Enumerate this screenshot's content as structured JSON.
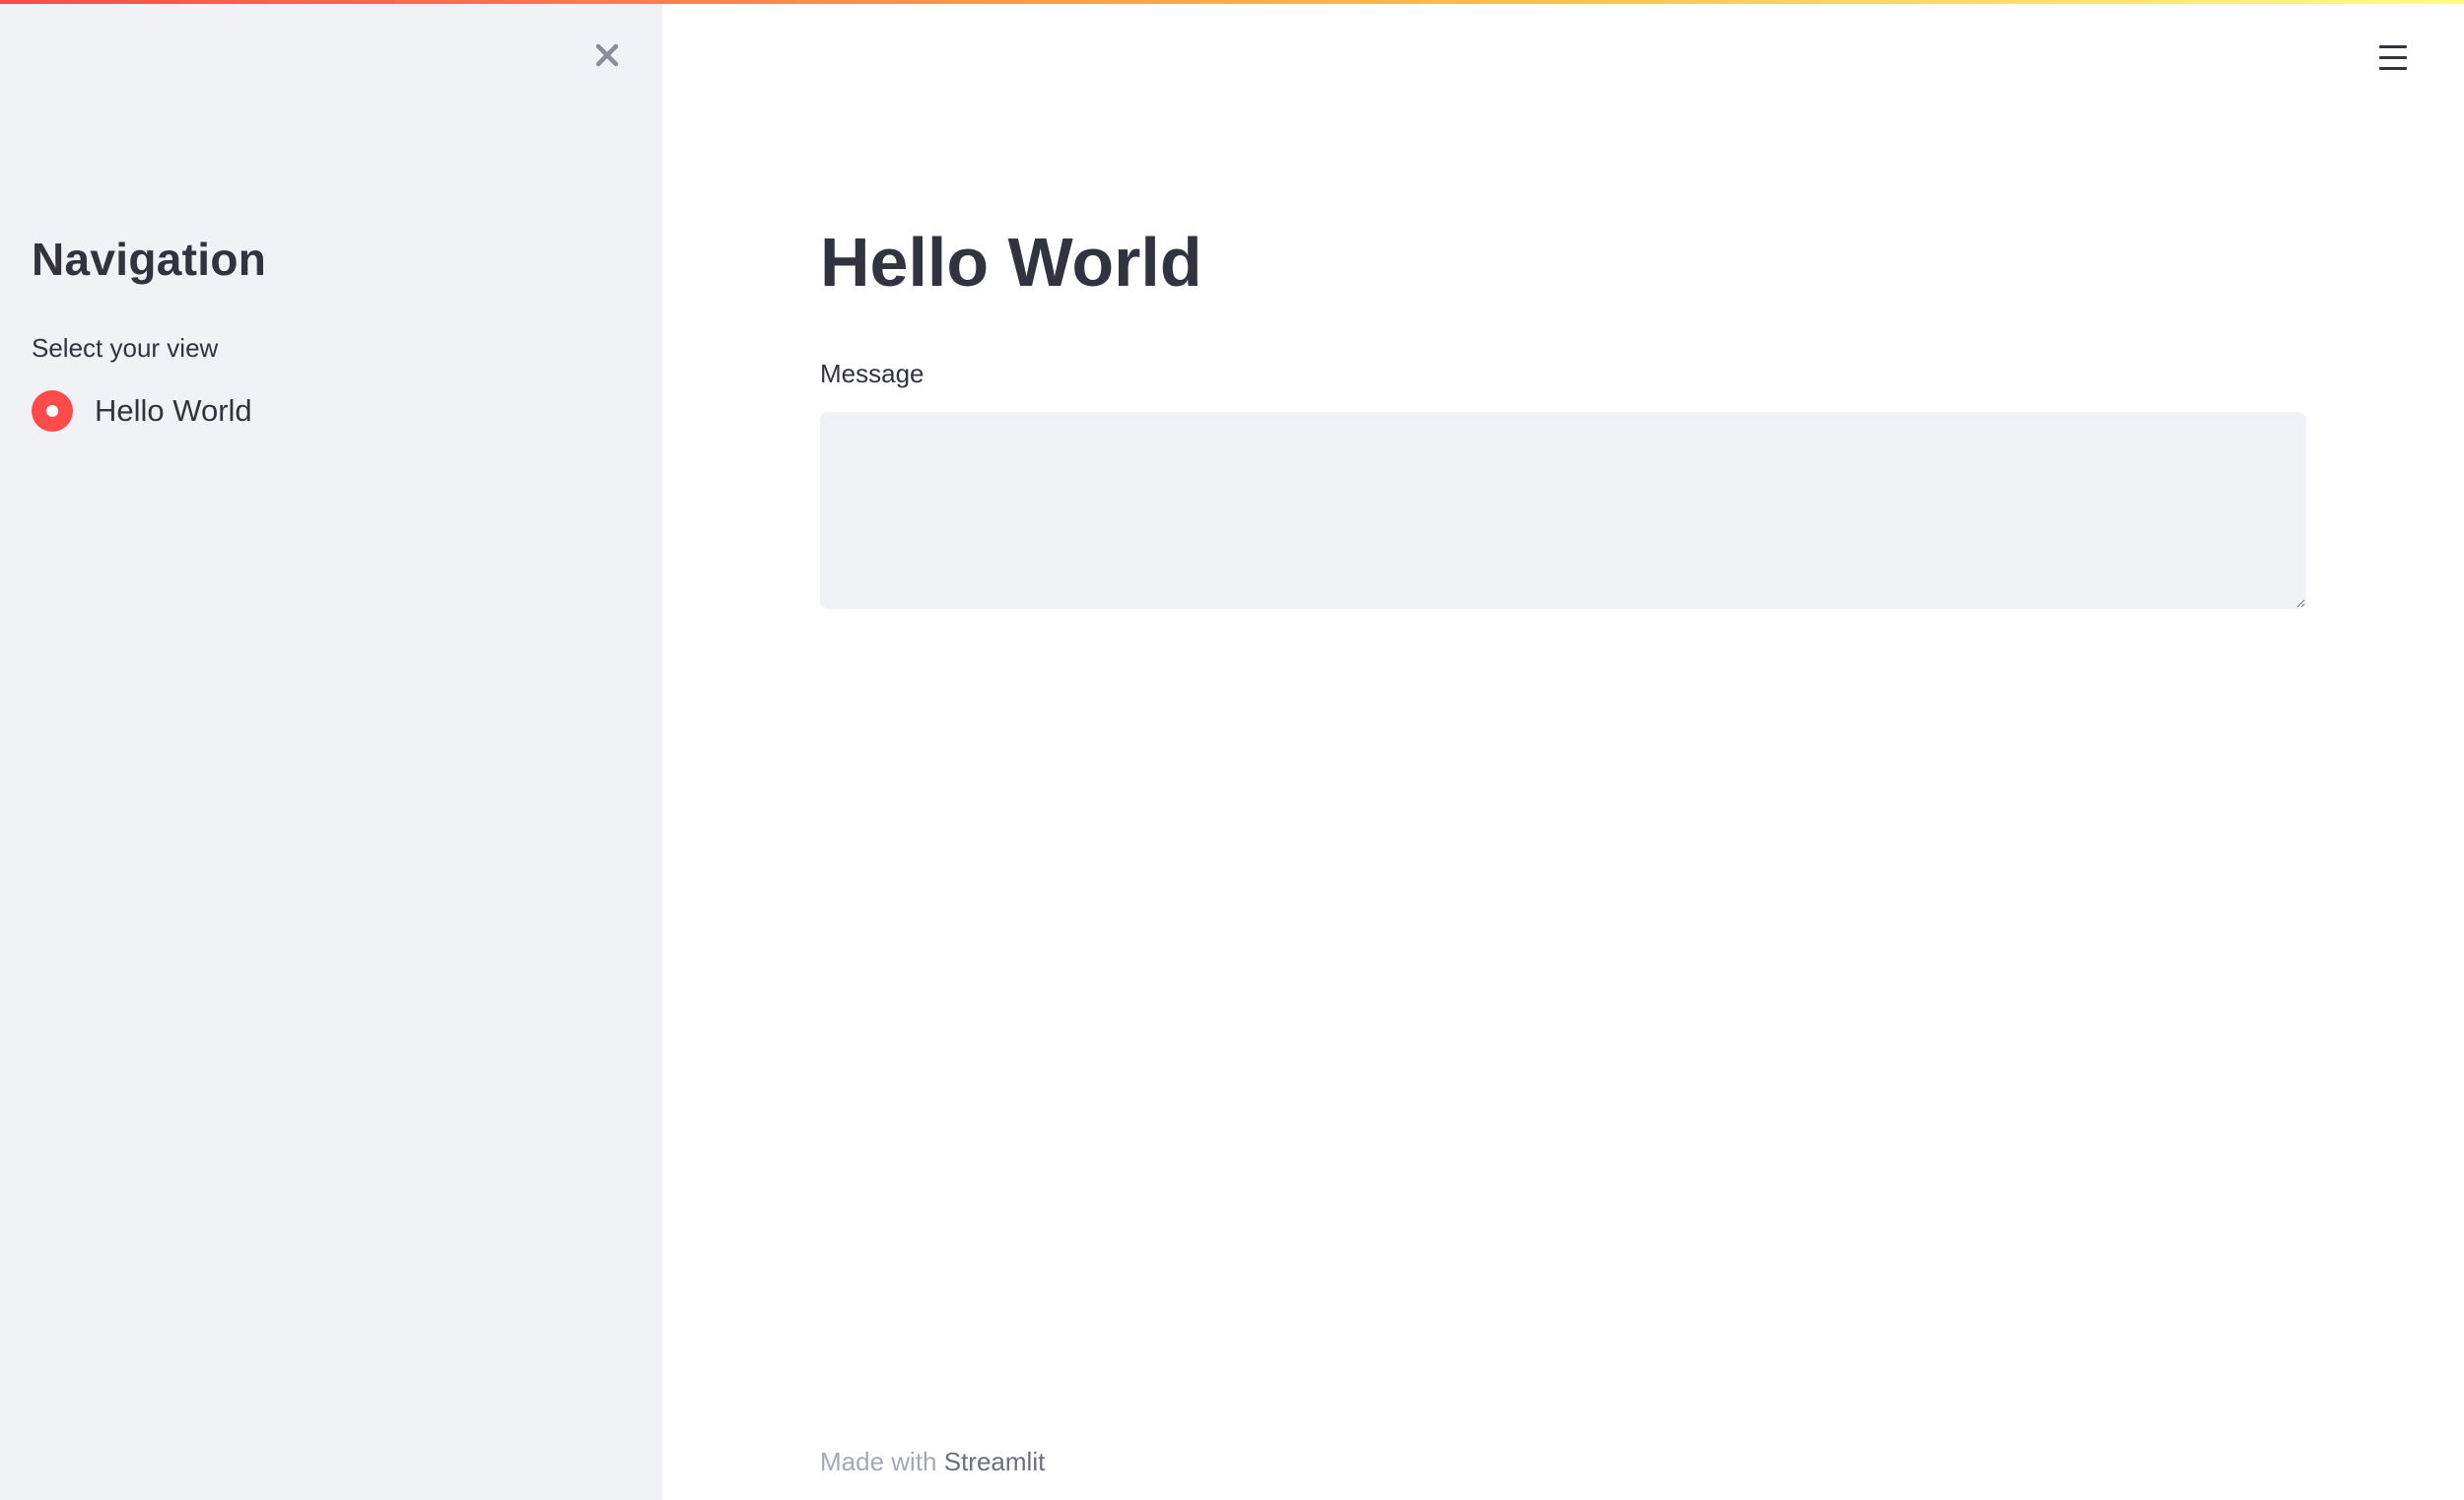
{
  "sidebar": {
    "close_icon": "close-icon",
    "title": "Navigation",
    "radio_group": {
      "label": "Select your view",
      "options": [
        {
          "label": "Hello World",
          "selected": true
        }
      ]
    }
  },
  "header": {
    "menu_icon": "hamburger-menu-icon"
  },
  "main": {
    "title": "Hello World",
    "message_field": {
      "label": "Message",
      "value": "",
      "placeholder": ""
    }
  },
  "footer": {
    "prefix": "Made with ",
    "link_text": "Streamlit"
  },
  "colors": {
    "accent": "#ff4b4b",
    "sidebar_bg": "#f0f2f6",
    "text": "#31333f",
    "muted_text": "#a3a8b4"
  }
}
